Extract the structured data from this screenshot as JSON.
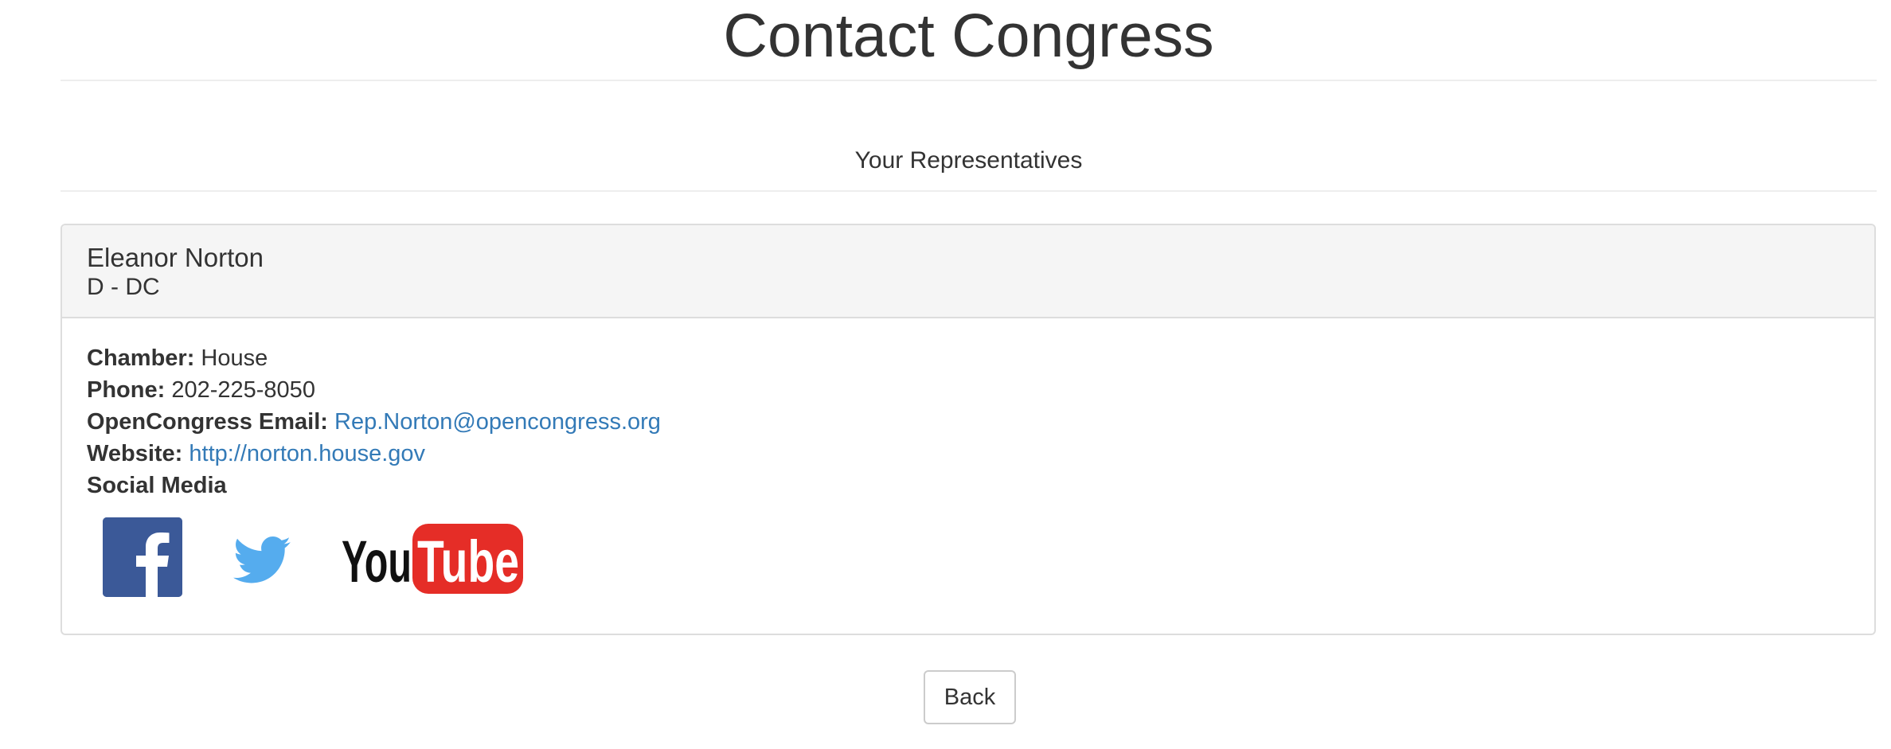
{
  "header": {
    "title": "Contact Congress",
    "subtitle": "Your Representatives"
  },
  "representative": {
    "name": "Eleanor Norton",
    "party_state": "D - DC",
    "chamber_label": "Chamber:",
    "chamber": "House",
    "phone_label": "Phone:",
    "phone": "202-225-8050",
    "email_label": "OpenCongress Email:",
    "email": "Rep.Norton@opencongress.org",
    "website_label": "Website:",
    "website": "http://norton.house.gov",
    "social_label": "Social Media",
    "social": [
      {
        "icon": "facebook-icon",
        "color": "#3b5998"
      },
      {
        "icon": "twitter-icon",
        "color": "#55acee"
      },
      {
        "icon": "youtube-icon",
        "color": "#e52d27"
      }
    ]
  },
  "actions": {
    "back_label": "Back"
  },
  "colors": {
    "link": "#337ab7",
    "panel_heading_bg": "#f5f5f5",
    "border": "#dddddd"
  }
}
